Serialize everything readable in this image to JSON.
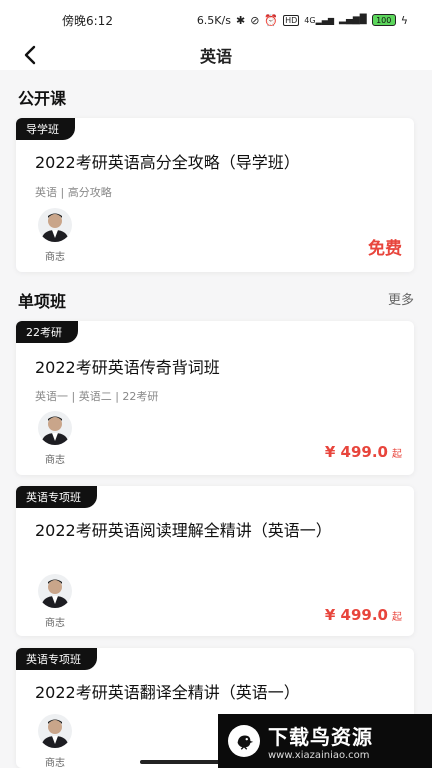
{
  "status_bar": {
    "time": "傍晚6:12",
    "net_speed": "6.5K/s",
    "icons": [
      "bluetooth-icon",
      "mute-icon",
      "alarm-icon",
      "hd-icon",
      "signal-4g-icon",
      "signal-icon"
    ],
    "battery": "100"
  },
  "nav": {
    "title": "英语"
  },
  "sections": {
    "open_course": {
      "title": "公开课"
    },
    "single_class": {
      "title": "单项班",
      "more_label": "更多"
    }
  },
  "cards": [
    {
      "tag": "导学班",
      "title": "2022考研英语高分全攻略（导学班）",
      "subtitle": "英语 | 高分攻略",
      "teacher": "商志",
      "price_free": "免费"
    },
    {
      "tag": "22考研",
      "title": "2022考研英语传奇背词班",
      "subtitle": "英语一 | 英语二 | 22考研",
      "teacher": "商志",
      "price": "¥ 499.0",
      "price_suffix": "起"
    },
    {
      "tag": "英语专项班",
      "title": "2022考研英语阅读理解全精讲（英语一）",
      "teacher": "商志",
      "price": "¥ 499.0",
      "price_suffix": "起"
    },
    {
      "tag": "英语专项班",
      "title": "2022考研英语翻译全精讲（英语一）",
      "teacher": "商志"
    }
  ],
  "watermark": {
    "name": "下载鸟资源",
    "url": "www.xiazainiao.com"
  },
  "colors": {
    "accent_price": "#e8453c",
    "tag_bg": "#111111",
    "page_bg": "#f6f6f7"
  }
}
